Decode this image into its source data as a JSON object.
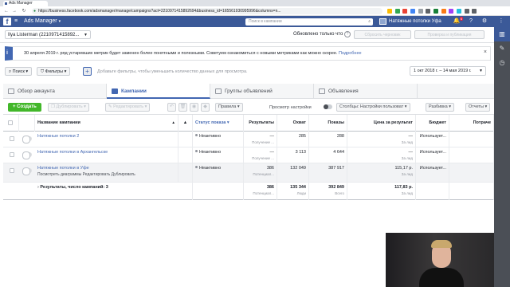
{
  "browser": {
    "tab_title": "Ads Manager",
    "url": "https://business.facebook.com/adsmanager/manage/campaigns?act=2210971415892694&business_id=165561930995996&columns=n..."
  },
  "topbar": {
    "app_title": "Ads Manager",
    "search_placeholder": "Поиск в кампании",
    "page_name": "Натяжные потолки Уфа",
    "notification_count": "6"
  },
  "account_row": {
    "account": "Ilya Listerman (2210971415892...",
    "updated": "Обновлено только что",
    "discard_label": "Сбросить черновик",
    "review_label": "Проверка и публикация"
  },
  "banner": {
    "text": "30 апреля 2019 г. ряд устаревших метрик будет заменен более понятными и полезными. Советуем ознакомиться с новыми метриками как можно скорее.",
    "link": "Подробнее"
  },
  "filters": {
    "search_label": "Поиск",
    "filters_label": "Фильтры",
    "hint": "Добавьте фильтры, чтобы уменьшить количество данных для просмотра.",
    "date_range": "1 окт 2018 г. – 14 мая 2019 г."
  },
  "level_tabs": [
    {
      "label": "Обзор аккаунта"
    },
    {
      "label": "Кампании"
    },
    {
      "label": "Группы объявлений"
    },
    {
      "label": "Объявления"
    }
  ],
  "toolbar": {
    "create": "Создать",
    "duplicate": "Дублировать",
    "edit": "Редактировать",
    "rules": "Правила",
    "view_settings": "Просмотр настройки",
    "columns": "Столбцы: Настройки пользоват",
    "breakdown": "Разбивка",
    "reports": "Отчеты"
  },
  "columns": {
    "name": "Название кампании",
    "status": "Статус показа",
    "results": "Результаты",
    "reach": "Охват",
    "impressions": "Показы",
    "cost_per_result": "Цена за результат",
    "budget": "Бюджет",
    "spent": "Потраче"
  },
  "rows": [
    {
      "name": "Натяжные потолки 2",
      "status": "Неактивно",
      "results": "—",
      "results_sub": "Получение ...",
      "reach": "285",
      "impressions": "288",
      "cost": "—",
      "cost_sub": "За лид",
      "budget": "Использует..."
    },
    {
      "name": "Натяжные потолки в Архангельске",
      "status": "Неактивно",
      "results": "—",
      "results_sub": "Получение ...",
      "reach": "3 113",
      "impressions": "4 644",
      "cost": "—",
      "cost_sub": "За лид",
      "budget": "Использует..."
    },
    {
      "name": "Натяжные потолки в Уфе",
      "actions": "Посмотреть диаграммы  Редактировать  Дублировать",
      "status": "Неактивно",
      "results": "386",
      "results_sub": "Потенциал...",
      "reach": "132 049",
      "impressions": "387 917",
      "cost": "115,17 р.",
      "cost_sub": "За лид",
      "budget": "Использует..."
    }
  ],
  "total": {
    "label": "Результаты, число кампаний: 3",
    "results": "386",
    "results_sub": "Потенциал...",
    "reach": "135 344",
    "reach_sub": "Люди",
    "impressions": "392 849",
    "impressions_sub": "Всего",
    "cost": "117,83 р.",
    "cost_sub": "За лид"
  },
  "colors": {
    "facebook_blue": "#3b5998",
    "accent": "#4267b2",
    "create_green": "#42b72a"
  }
}
